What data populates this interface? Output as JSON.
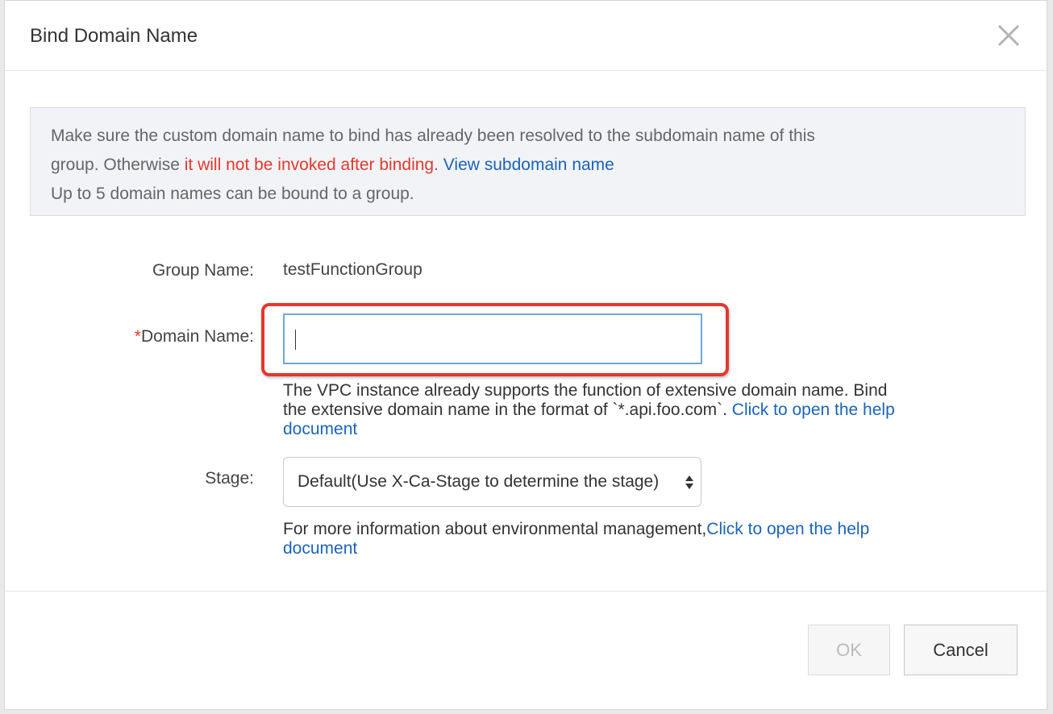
{
  "dialog": {
    "title": "Bind Domain Name"
  },
  "notice": {
    "line1": "Make sure the custom domain name to bind has already been resolved to the subdomain name of this",
    "line2_prefix": "group. Otherwise ",
    "line2_warning": "it will not be invoked after binding",
    "line2_period": ". ",
    "line2_link": "View subdomain name",
    "line3": "Up to 5 domain names can be bound to a group.",
    "warning_color": "#e23a2c",
    "link_color": "#1b64b8"
  },
  "form": {
    "group_name_label": "Group Name:",
    "group_name_value": "testFunctionGroup",
    "domain_required_mark": "*",
    "domain_label": "Domain Name:",
    "domain_value": "",
    "domain_help_line1": "The VPC instance already supports the function of extensive domain name. Bind",
    "domain_help_line2": "the extensive domain name in the format of `*.api.foo.com`. ",
    "domain_help_link_a": "Click to open the help",
    "domain_help_link_b": "document",
    "stage_label": "Stage:",
    "stage_selected": "Default(Use X-Ca-Stage to determine the stage)",
    "stage_help_text": "For more information about environmental management,",
    "stage_help_link_a": "Click to open the help",
    "stage_help_link_b": "document"
  },
  "buttons": {
    "ok": "OK",
    "cancel": "Cancel"
  },
  "icons": {
    "close": "close-icon",
    "select_arrows": "chevron-up-down-icon"
  }
}
